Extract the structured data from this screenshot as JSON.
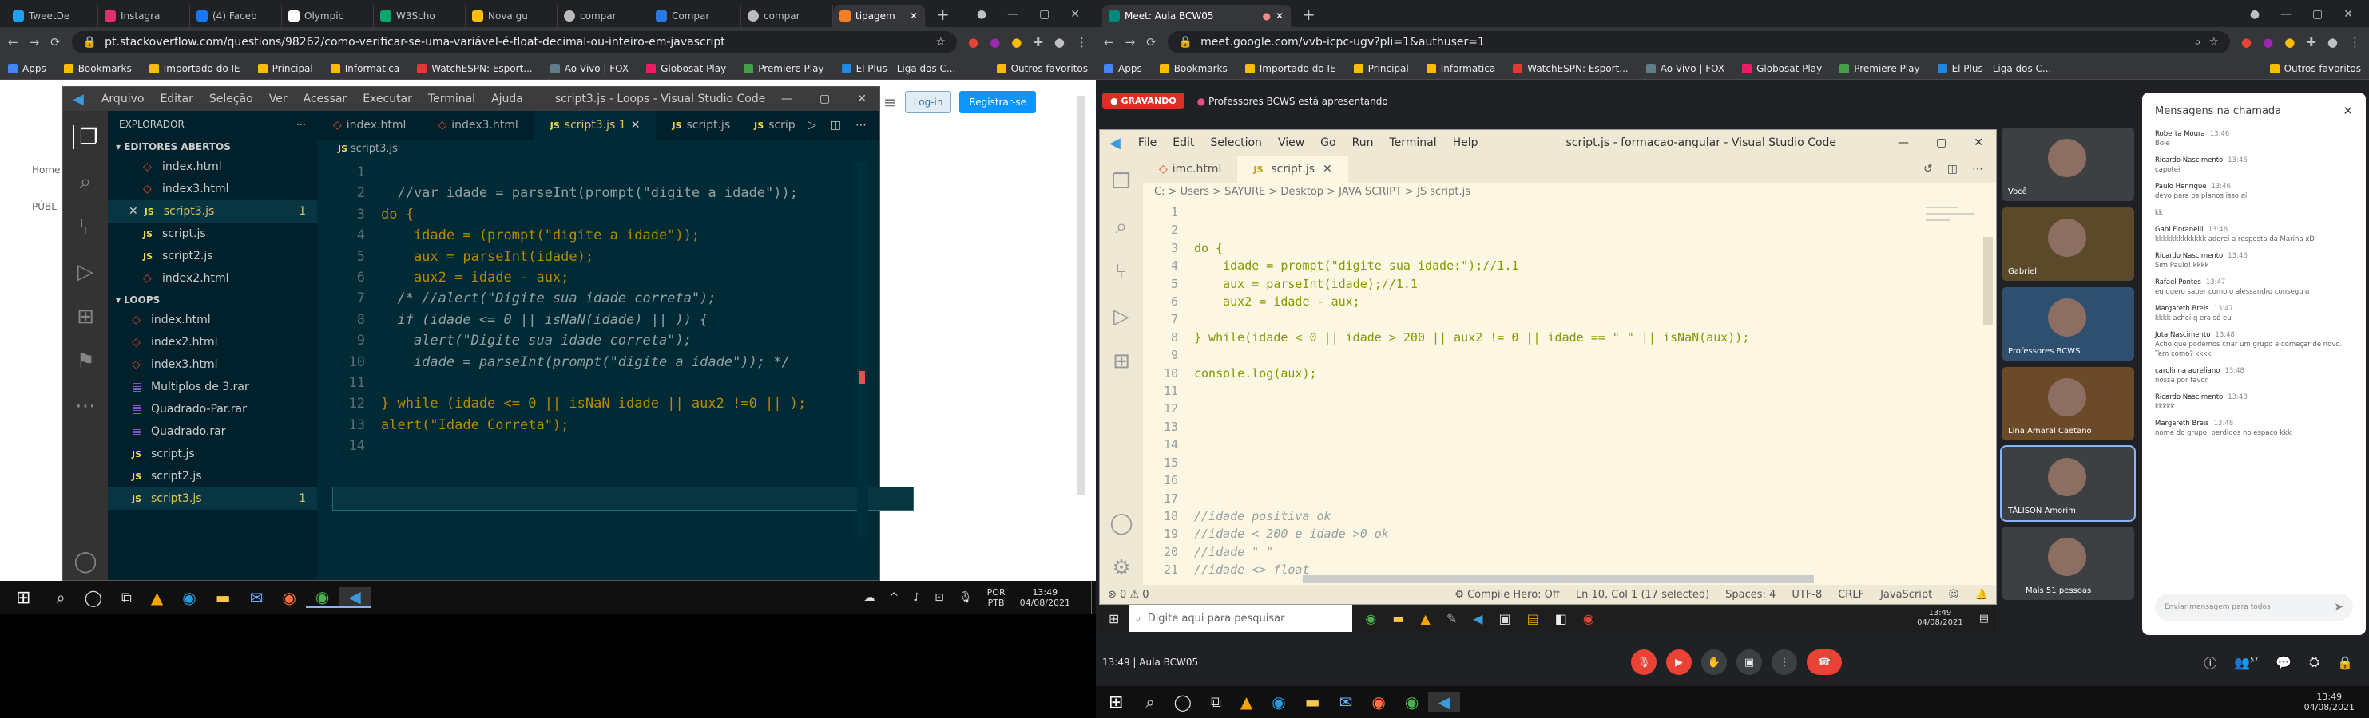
{
  "left_browser": {
    "tabs": [
      "TweetDe",
      "Instagra",
      "(4) Faceb",
      "Olympic",
      "W3Scho",
      "Nova gu",
      "compar",
      "Compar",
      "compar",
      "tipagem"
    ],
    "url": "pt.stackoverflow.com/questions/98262/como-verificar-se-uma-variável-é-float-decimal-ou-inteiro-em-javascript",
    "bookmarks": [
      "Apps",
      "Bookmarks",
      "Importado do IE",
      "Principal",
      "Informatica",
      "WatchESPN: Esport...",
      "Ao Vivo | FOX",
      "Globosat Play",
      "Premiere Play",
      "El Plus - Liga dos C...",
      "Outros favoritos"
    ],
    "so_login": "Log-in",
    "so_signup": "Registrar-se",
    "so_side": [
      "Home",
      "PÚBL"
    ]
  },
  "vscode_left": {
    "menu": [
      "Arquivo",
      "Editar",
      "Seleção",
      "Ver",
      "Acessar",
      "Executar",
      "Terminal",
      "Ajuda"
    ],
    "title": "script3.js - Loops - Visual Studio Code",
    "tabs": [
      "index.html",
      "index3.html",
      "script3.js 1",
      "script.js",
      "scrip"
    ],
    "breadcrumb": "script3.js",
    "explorer_title": "EXPLORADOR",
    "open_editors": "EDITORES ABERTOS",
    "open_files": [
      "index.html",
      "index3.html",
      "script3.js",
      "script.js",
      "script2.js",
      "index2.html"
    ],
    "loops": "LOOPS",
    "loop_files": [
      "index.html",
      "index2.html",
      "index3.html",
      "Multiplos de 3.rar",
      "Quadrado-Par.rar",
      "Quadrado.rar",
      "script.js",
      "script2.js",
      "script3.js"
    ],
    "badge": "1",
    "lines": [
      "",
      "  //var idade = parseInt(prompt(\"digite a idade\"));",
      "do {",
      "    idade = (prompt(\"digite a idade\"));",
      "    aux = parseInt(idade);",
      "    aux2 = idade - aux;",
      "  /* //alert(\"Digite sua idade correta\");",
      "  if (idade <= 0 || isNaN(idade) || )) {",
      "    alert(\"Digite sua idade correta\");",
      "    idade = parseInt(prompt(\"digite a idade\")); */",
      "",
      "} while (idade <= 0 || isNaN idade || aux2 !=0 || );",
      "alert(\"Idade Correta\");",
      ""
    ]
  },
  "taskbar_left": {
    "lang": "POR",
    "kbd": "PTB",
    "time": "13:49",
    "date": "04/08/2021"
  },
  "right_browser": {
    "tab": "Meet: Aula BCW05",
    "url": "meet.google.com/vvb-icpc-ugv?pli=1&authuser=1",
    "recording": "GRAVANDO",
    "presenting": "Professores BCWS está apresentando"
  },
  "vscode_right": {
    "menu": [
      "File",
      "Edit",
      "Selection",
      "View",
      "Go",
      "Run",
      "Terminal",
      "Help"
    ],
    "title": "script.js - formacao-angular - Visual Studio Code",
    "tabs": [
      "imc.html",
      "script.js"
    ],
    "breadcrumb": "C: > Users > SAYURE > Desktop > JAVA SCRIPT > JS script.js",
    "lines": [
      "",
      "",
      "do {",
      "    idade = prompt(\"digite sua idade:\");//1.1",
      "    aux = parseInt(idade);//1.1",
      "    aux2 = idade - aux;",
      "",
      "} while(idade < 0 || idade > 200 || aux2 != 0 || idade == \" \" || isNaN(aux));",
      "",
      "console.log(aux);",
      "",
      "",
      "",
      "",
      "",
      "",
      "",
      "//idade positiva ok",
      "//idade < 200 e idade >0 ok",
      "//idade \" \"",
      "//idade <> float"
    ],
    "status": [
      "Compile Hero: Off",
      "Ln 10, Col 1 (17 selected)",
      "Spaces: 4",
      "UTF-8",
      "CRLF",
      "JavaScript"
    ],
    "errors": "0",
    "warnings": "0",
    "search": "Digite aqui para pesquisar",
    "time": "13:49",
    "date": "04/08/2021"
  },
  "meet": {
    "participants": [
      "Você",
      "Gabriel",
      "Professores BCWS",
      "Lina Amaral Caetano",
      "TÁLISON Amorim",
      "Mais 51 pessoas"
    ],
    "chat_title": "Mensagens na chamada",
    "chat": [
      [
        "Roberta Moura",
        "13:46",
        "Boie"
      ],
      [
        "Ricardo Nascimento",
        "13:46",
        "capotei"
      ],
      [
        "Paulo Henrique",
        "13:46",
        "devo para os planos isso ai"
      ],
      [
        "",
        "",
        "kk"
      ],
      [
        "Gabi Fioranelli",
        "13:46",
        "kkkkkkkkkkkkk adorei a resposta da Marina xD"
      ],
      [
        "Ricardo Nascimento",
        "13:46",
        "Sim Paulo! kkkk"
      ],
      [
        "Rafael Pontes",
        "13:47",
        "eu quero saber como o alessandro conseguiu"
      ],
      [
        "Margareth Breis",
        "13:47",
        "kkkk achei q era só eu"
      ],
      [
        "Jota Nascimento",
        "13:48",
        "Acho que podemos criar um grupo e começar de novo.. Tem como? kkkk"
      ],
      [
        "carolinna aureliano",
        "13:48",
        "nossa por favor"
      ],
      [
        "Ricardo Nascimento",
        "13:48",
        "kkkkk"
      ],
      [
        "Margareth Breis",
        "13:48",
        "nome do grupo: perdidos no espaço kkk"
      ]
    ],
    "chat_placeholder": "Enviar mensagem para todos",
    "bottom_time": "13:49",
    "bottom_sep": "|",
    "bottom_title": "Aula BCW05",
    "people_count": "57"
  },
  "taskbar_right": {
    "time": "13:49",
    "date": "04/08/2021"
  }
}
